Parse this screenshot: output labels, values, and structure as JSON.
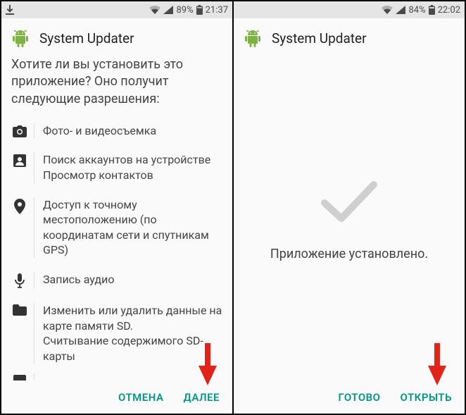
{
  "left": {
    "status": {
      "battery": "89%",
      "time": "21:37"
    },
    "title": "System Updater",
    "prompt": "Хотите ли вы установить это приложение? Оно получит следующие разрешения:",
    "perms": [
      {
        "icon": "camera",
        "text": "Фото- и видеосъемка"
      },
      {
        "icon": "contacts",
        "text": "Поиск аккаунтов на устройстве\nПросмотр контактов"
      },
      {
        "icon": "location",
        "text": "Доступ к точному местоположению (по координатам сети и спутникам GPS)"
      },
      {
        "icon": "mic",
        "text": "Запись аудио"
      },
      {
        "icon": "storage",
        "text": "Изменить или удалить данные на карте памяти SD.\nСчитывание содержимого SD-карты"
      }
    ],
    "buttons": {
      "cancel": "ОТМЕНА",
      "next": "ДАЛЕЕ"
    }
  },
  "right": {
    "status": {
      "battery": "84%",
      "time": "22:02"
    },
    "title": "System Updater",
    "installed": "Приложение установлено.",
    "buttons": {
      "done": "ГОТОВО",
      "open": "ОТКРЫТЬ"
    }
  }
}
